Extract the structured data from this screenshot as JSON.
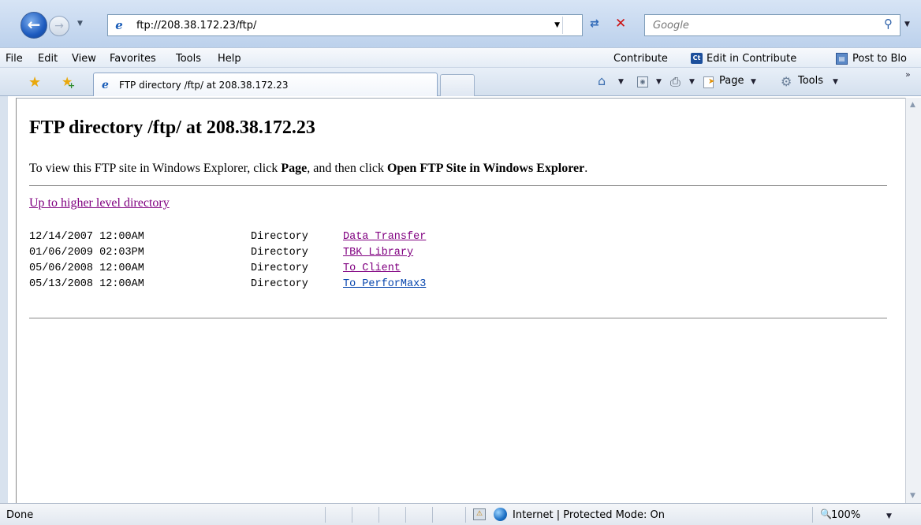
{
  "browser": {
    "address": "ftp://208.38.172.23/ftp/",
    "search_placeholder": "Google"
  },
  "menu": {
    "items": [
      "File",
      "Edit",
      "View",
      "Favorites",
      "Tools",
      "Help"
    ],
    "contribute": "Contribute",
    "edit_in_contribute": "Edit in Contribute",
    "post_to_blog": "Post to Blo"
  },
  "tabs": {
    "active_label": "FTP directory /ftp/ at 208.38.172.23"
  },
  "command_bar": {
    "page": "Page",
    "tools": "Tools"
  },
  "page": {
    "title": "FTP directory /ftp/ at 208.38.172.23",
    "intro_prefix": "To view this FTP site in Windows Explorer, click ",
    "intro_page": "Page",
    "intro_mid": ", and then click ",
    "intro_open": "Open FTP Site in Windows Explorer",
    "intro_suffix": ".",
    "up_link": "Up to higher level directory",
    "entries": [
      {
        "date": "12/14/2007 12:00AM",
        "kind": "Directory",
        "name": "Data_Transfer"
      },
      {
        "date": "01/06/2009 02:03PM",
        "kind": "Directory",
        "name": "TBK_Library"
      },
      {
        "date": "05/06/2008 12:00AM",
        "kind": "Directory",
        "name": "To_Client"
      },
      {
        "date": "05/13/2008 12:00AM",
        "kind": "Directory",
        "name": "To_PerforMax3"
      }
    ]
  },
  "status": {
    "text": "Done",
    "zone": "Internet | Protected Mode: On",
    "zoom": "100%"
  },
  "colors": {
    "visited_link": "#800080",
    "unvisited_link": "#0645ad"
  }
}
